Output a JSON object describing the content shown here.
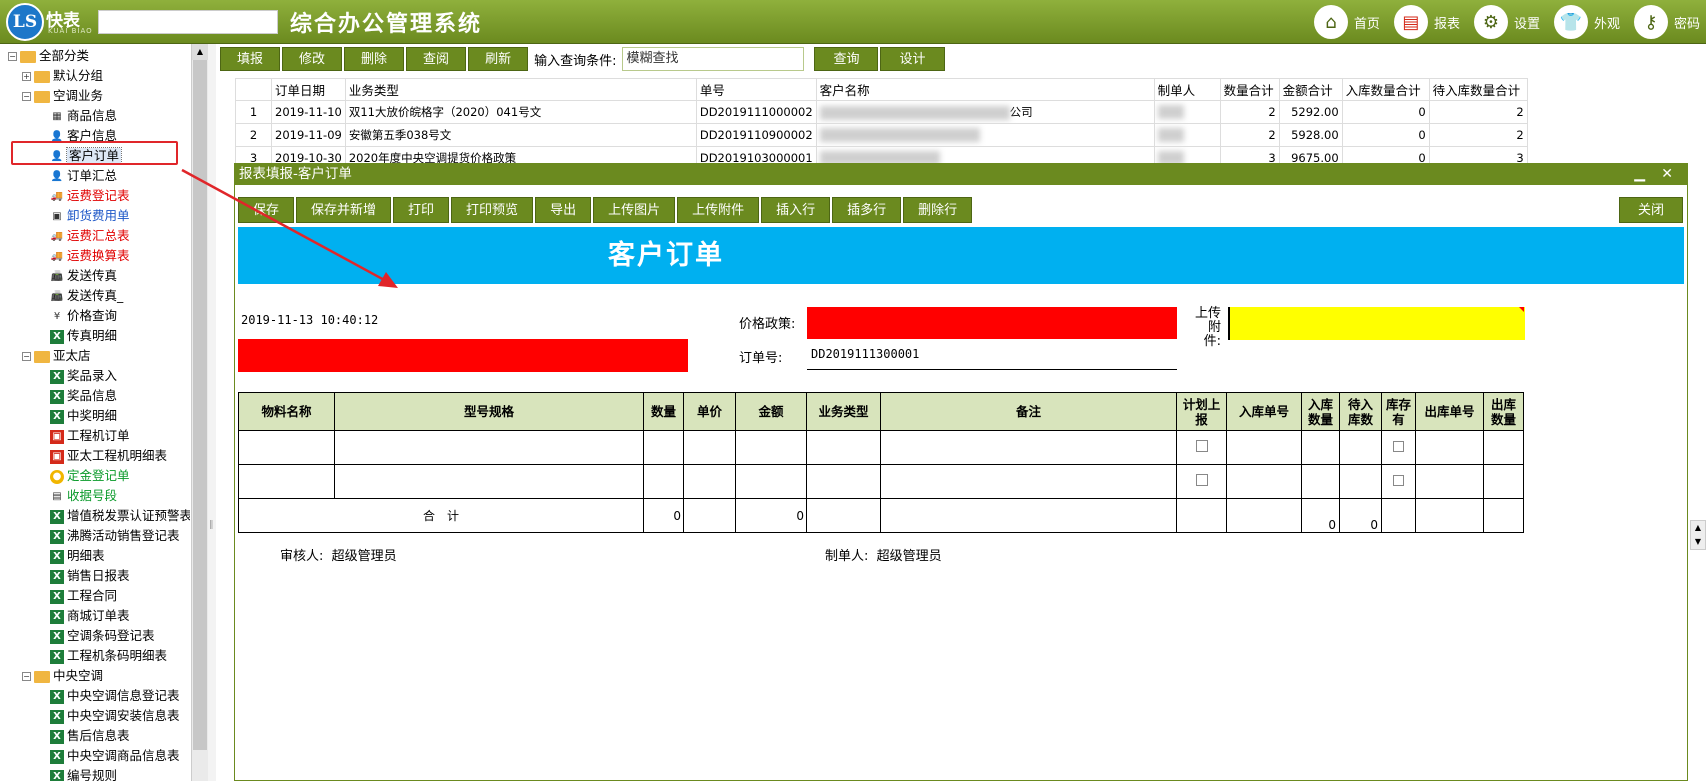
{
  "header": {
    "logo_letters": "LS",
    "logo_name": "快表",
    "logo_sub": "KUAI BIAO",
    "app_title": "综合办公管理系统",
    "nav": [
      {
        "label": "首页",
        "icon": "home-icon"
      },
      {
        "label": "报表",
        "icon": "report-icon"
      },
      {
        "label": "设置",
        "icon": "gear-icon"
      },
      {
        "label": "外观",
        "icon": "shirt-icon"
      },
      {
        "label": "密码",
        "icon": "key-icon"
      }
    ]
  },
  "sidebar": {
    "root": "全部分类",
    "items": [
      {
        "label": "默认分组",
        "level": 1,
        "type": "folder",
        "exp": "+"
      },
      {
        "label": "空调业务",
        "level": 1,
        "type": "folder",
        "exp": "−"
      },
      {
        "label": "商品信息",
        "level": 2,
        "type": "grid"
      },
      {
        "label": "客户信息",
        "level": 2,
        "type": "user"
      },
      {
        "label": "客户订单",
        "level": 2,
        "type": "user",
        "selected": true
      },
      {
        "label": "订单汇总",
        "level": 2,
        "type": "user"
      },
      {
        "label": "运费登记表",
        "level": 2,
        "type": "truck",
        "color": "#e00000"
      },
      {
        "label": "卸货费用单",
        "level": 2,
        "type": "forklift",
        "color": "#1c56c7"
      },
      {
        "label": "运费汇总表",
        "level": 2,
        "type": "truck",
        "color": "#e00000"
      },
      {
        "label": "运费换算表",
        "level": 2,
        "type": "truck",
        "color": "#e00000"
      },
      {
        "label": "发送传真",
        "level": 2,
        "type": "fax"
      },
      {
        "label": "发送传真_",
        "level": 2,
        "type": "fax"
      },
      {
        "label": "价格查询",
        "level": 2,
        "type": "yen"
      },
      {
        "label": "传真明细",
        "level": 2,
        "type": "xl"
      },
      {
        "label": "亚太店",
        "level": 1,
        "type": "folder",
        "exp": "−"
      },
      {
        "label": "奖品录入",
        "level": 2,
        "type": "xl"
      },
      {
        "label": "奖品信息",
        "level": 2,
        "type": "xl"
      },
      {
        "label": "中奖明细",
        "level": 2,
        "type": "xl"
      },
      {
        "label": "工程机订单",
        "level": 2,
        "type": "rd"
      },
      {
        "label": "亚太工程机明细表",
        "level": 2,
        "type": "rd"
      },
      {
        "label": "定金登记单",
        "level": 2,
        "type": "co",
        "color": "#0a9a2a"
      },
      {
        "label": "收据号段",
        "level": 2,
        "type": "box",
        "color": "#0a9a2a"
      },
      {
        "label": "增值税发票认证预警表",
        "level": 2,
        "type": "xl"
      },
      {
        "label": "沸腾活动销售登记表",
        "level": 2,
        "type": "xl"
      },
      {
        "label": "明细表",
        "level": 2,
        "type": "xl"
      },
      {
        "label": "销售日报表",
        "level": 2,
        "type": "xl"
      },
      {
        "label": "工程合同",
        "level": 2,
        "type": "xl"
      },
      {
        "label": "商城订单表",
        "level": 2,
        "type": "xl"
      },
      {
        "label": "空调条码登记表",
        "level": 2,
        "type": "xl"
      },
      {
        "label": "工程机条码明细表",
        "level": 2,
        "type": "xl"
      },
      {
        "label": "中央空调",
        "level": 1,
        "type": "folder",
        "exp": "−"
      },
      {
        "label": "中央空调信息登记表",
        "level": 2,
        "type": "xl"
      },
      {
        "label": "中央空调安装信息表",
        "level": 2,
        "type": "xl"
      },
      {
        "label": "售后信息表",
        "level": 2,
        "type": "xl"
      },
      {
        "label": "中央空调商品信息表",
        "level": 2,
        "type": "xl"
      },
      {
        "label": "编号规则",
        "level": 2,
        "type": "xl"
      }
    ]
  },
  "toolbar": {
    "buttons": [
      "填报",
      "修改",
      "删除",
      "查阅",
      "刷新"
    ],
    "query_label": "输入查询条件:",
    "query_value": "模糊查找",
    "query_button": "查询",
    "design_button": "设计"
  },
  "grid": {
    "headers": [
      "订单日期",
      "业务类型",
      "单号",
      "客户名称",
      "制单人",
      "数量合计",
      "金额合计",
      "入库数量合计",
      "待入库数量合计"
    ],
    "rows": [
      {
        "n": "1",
        "date": "2019-11-10",
        "type": "双11大放价皖格字（2020）041号文",
        "no": "DD2019111000002",
        "client": "公司",
        "maker": "",
        "qty": "2",
        "amt": "5292.00",
        "in": "0",
        "pending": "2"
      },
      {
        "n": "2",
        "date": "2019-11-09",
        "type": "安徽第五季038号文",
        "no": "DD2019110900002",
        "client": "",
        "maker": "",
        "qty": "2",
        "amt": "5928.00",
        "in": "0",
        "pending": "2"
      },
      {
        "n": "3",
        "date": "2019-10-30",
        "type": "2020年度中央空调提货价格政策",
        "no": "DD2019103000001",
        "client": "",
        "maker": "",
        "qty": "3",
        "amt": "9675.00",
        "in": "0",
        "pending": "3"
      }
    ]
  },
  "dialog": {
    "title": "报表填报-客户订单",
    "minimize": "▁",
    "close": "✕",
    "buttons": [
      "保存",
      "保存并新增",
      "打印",
      "打印预览",
      "导出",
      "上传图片",
      "上传附件",
      "插入行",
      "插多行",
      "删除行"
    ],
    "close_button": "关闭",
    "form_title": "客户订单",
    "timestamp": "2019-11-13 10:40:12",
    "price_policy_label": "价格政策:",
    "order_no_label": "订单号:",
    "order_no": "DD2019111300001",
    "attach_label_1": "上传附",
    "attach_label_2": "件:",
    "table_headers": [
      "物料名称",
      "型号规格",
      "数量",
      "单价",
      "金额",
      "业务类型",
      "备注",
      "计划上报",
      "入库单号",
      "入库数量",
      "待入库数",
      "库存有",
      "出库单号",
      "出库数量"
    ],
    "total_label": "合　计",
    "total_qty": "0",
    "total_amt": "0",
    "total_in": "0",
    "total_pending": "0",
    "reviewer_label": "审核人:",
    "reviewer": "超级管理员",
    "maker_label": "制单人:",
    "maker": "超级管理员"
  },
  "colors": {
    "accent": "#6b8a1f",
    "banner": "#00b0f0",
    "header_fill": "#d8e4bc",
    "highlight_red": "#ff0000",
    "highlight_yellow": "#ffff00",
    "annotation": "#e0262a"
  }
}
